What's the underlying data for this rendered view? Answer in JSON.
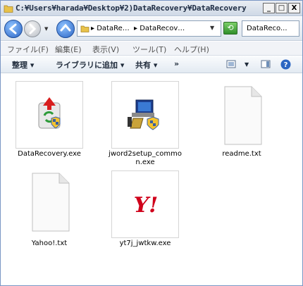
{
  "window": {
    "title": "C:¥Users¥harada¥Desktop¥2)DataRecovery¥DataRecovery",
    "buttons": {
      "minimize": "_",
      "maximize": "□",
      "close": "X"
    }
  },
  "nav": {
    "address_segments": [
      "▸ DataRe…",
      "▸ DataRecov…"
    ],
    "search_value": "DataReco..."
  },
  "menu": {
    "items": [
      "ファイル(F)",
      "編集(E)",
      "表示(V)",
      "ツール(T)",
      "ヘルプ(H)"
    ]
  },
  "commands": {
    "organize": "整理  ▾",
    "add_to_library": "ライブラリに追加  ▾",
    "share": "共有  ▾",
    "more": "»"
  },
  "files": [
    {
      "name": "DataRecovery.exe",
      "icon": "recycle-shield-icon"
    },
    {
      "name": "jword2setup_common.exe",
      "icon": "installer-icon"
    },
    {
      "name": "readme.txt",
      "icon": "text-file-icon"
    },
    {
      "name": "Yahoo!.txt",
      "icon": "text-file-icon"
    },
    {
      "name": "yt7j_jwtkw.exe",
      "icon": "yahoo-logo-icon",
      "logo_text": "Y!"
    }
  ],
  "colors": {
    "yahoo_red": "#d0021b",
    "nav_blue": "#2a64c4"
  }
}
